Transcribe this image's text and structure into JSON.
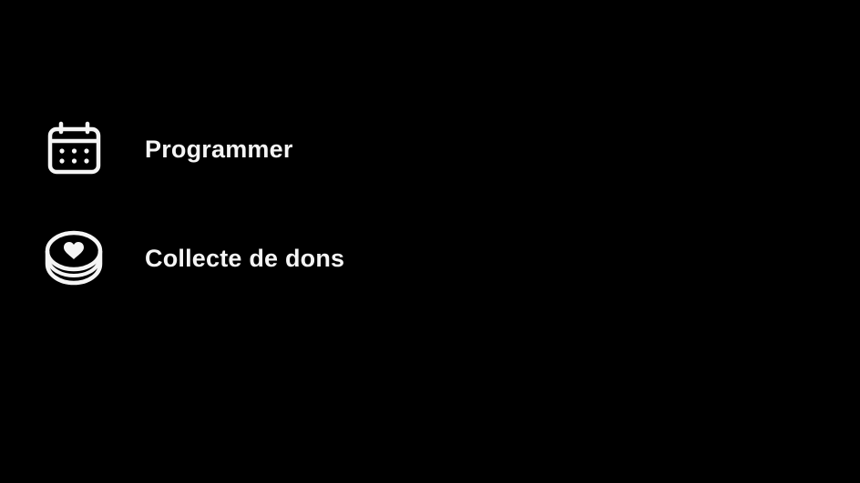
{
  "menu": {
    "items": [
      {
        "label": "Programmer",
        "icon": "calendar-icon"
      },
      {
        "label": "Collecte de dons",
        "icon": "donation-heart-icon"
      }
    ]
  },
  "colors": {
    "background": "#000000",
    "foreground": "#f5f5f5"
  }
}
